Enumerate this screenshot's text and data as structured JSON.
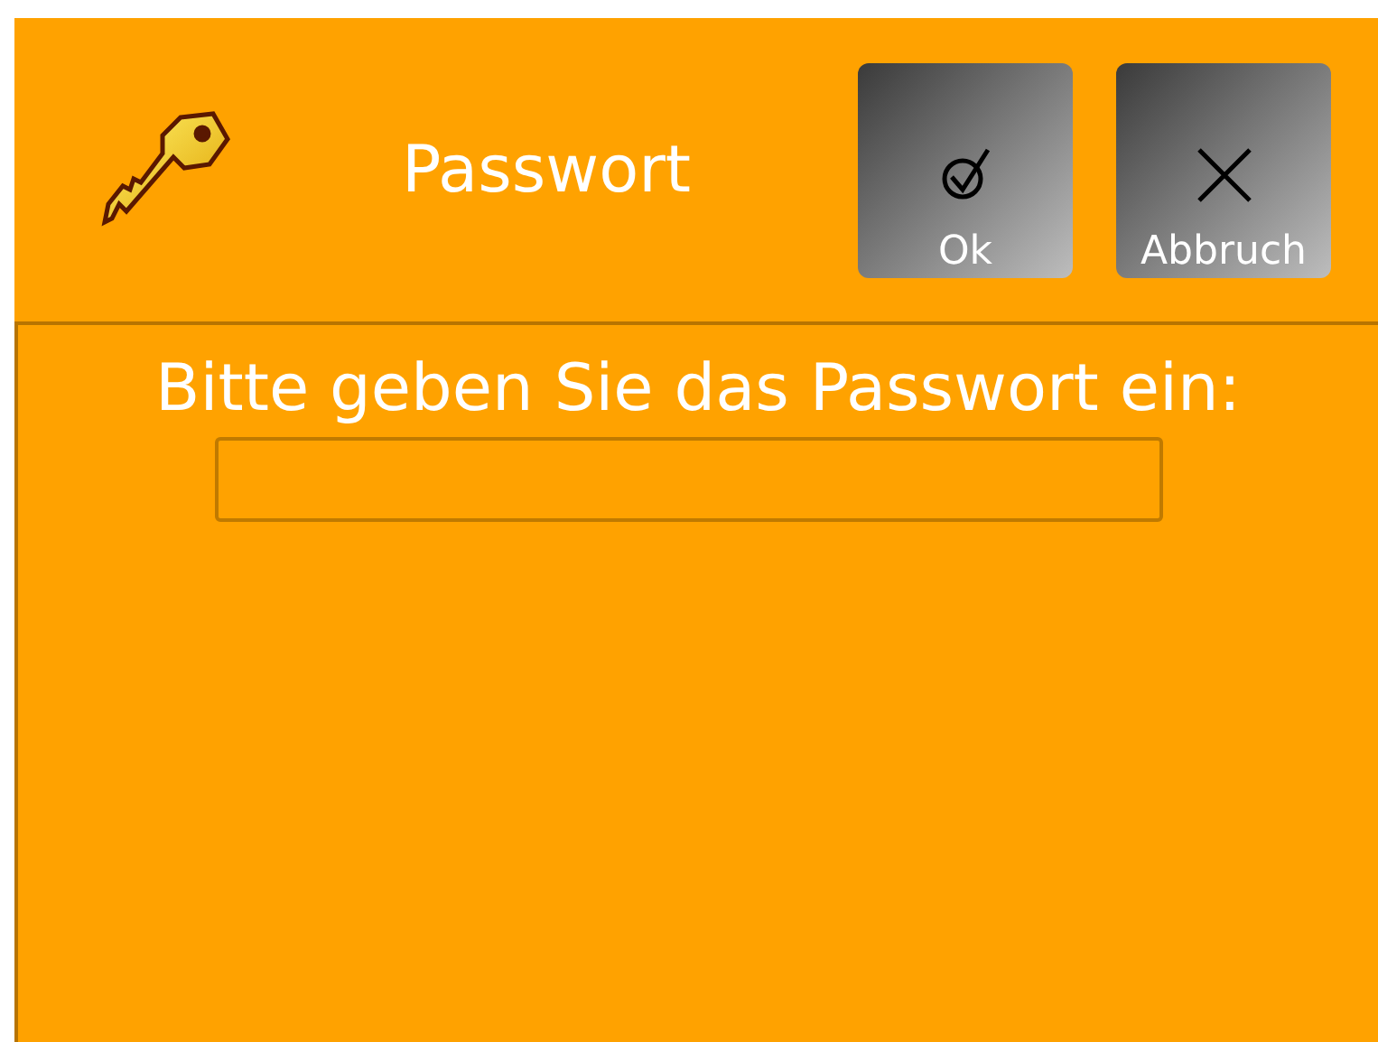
{
  "header": {
    "title": "Passwort",
    "buttons": [
      {
        "kind": "ok",
        "label": "Ok"
      },
      {
        "kind": "cancel",
        "label": "Abbruch"
      }
    ]
  },
  "prompt": {
    "text": "Bitte geben Sie das Passwort ein:"
  }
}
